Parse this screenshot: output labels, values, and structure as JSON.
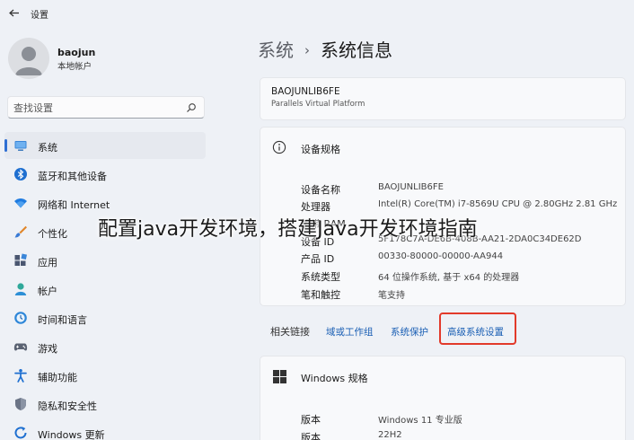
{
  "window": {
    "title": "设置"
  },
  "user": {
    "name": "baojun",
    "account_type": "本地帐户"
  },
  "search": {
    "placeholder": "查找设置"
  },
  "nav": {
    "items": [
      {
        "label": "系统",
        "icon": "monitor-icon",
        "active": true
      },
      {
        "label": "蓝牙和其他设备",
        "icon": "bluetooth-icon"
      },
      {
        "label": "网络和 Internet",
        "icon": "wifi-icon"
      },
      {
        "label": "个性化",
        "icon": "brush-icon"
      },
      {
        "label": "应用",
        "icon": "apps-icon"
      },
      {
        "label": "帐户",
        "icon": "account-icon"
      },
      {
        "label": "时间和语言",
        "icon": "clock-globe-icon"
      },
      {
        "label": "游戏",
        "icon": "gamepad-icon"
      },
      {
        "label": "辅助功能",
        "icon": "accessibility-icon"
      },
      {
        "label": "隐私和安全性",
        "icon": "shield-icon"
      },
      {
        "label": "Windows 更新",
        "icon": "update-icon"
      }
    ]
  },
  "breadcrumb": {
    "parent": "系统",
    "separator": "›",
    "current": "系统信息"
  },
  "device": {
    "name": "BAOJUNLIB6FE",
    "model": "Parallels Virtual Platform"
  },
  "device_specs": {
    "title": "设备规格",
    "rows": [
      {
        "label": "设备名称",
        "value": "BAOJUNLIB6FE"
      },
      {
        "label": "处理器",
        "value": "Intel(R) Core(TM) i7-8569U CPU @ 2.80GHz   2.81 GHz"
      },
      {
        "label": "机带 RAM",
        "value": ""
      },
      {
        "label": "设备 ID",
        "value": "5F178C7A-DE6B-408B-AA21-2DA0C34DE62D"
      },
      {
        "label": "产品 ID",
        "value": "00330-80000-00000-AA944"
      },
      {
        "label": "系统类型",
        "value": "64 位操作系统, 基于 x64 的处理器"
      },
      {
        "label": "笔和触控",
        "value": "笔支持"
      }
    ]
  },
  "related": {
    "label": "相关链接",
    "links": [
      "域或工作组",
      "系统保护",
      "高级系统设置"
    ]
  },
  "windows_specs": {
    "title": "Windows 规格",
    "rows": [
      {
        "label": "版本",
        "value": "Windows 11 专业版"
      },
      {
        "label": "版本",
        "value": "22H2"
      }
    ]
  },
  "overlay": {
    "caption": "配置java开发环境，搭建Java开发环境指南"
  },
  "colors": {
    "accent": "#2f6fd3",
    "link": "#1a5fb4",
    "highlight": "#e23a2a",
    "background": "#eef1f6"
  }
}
